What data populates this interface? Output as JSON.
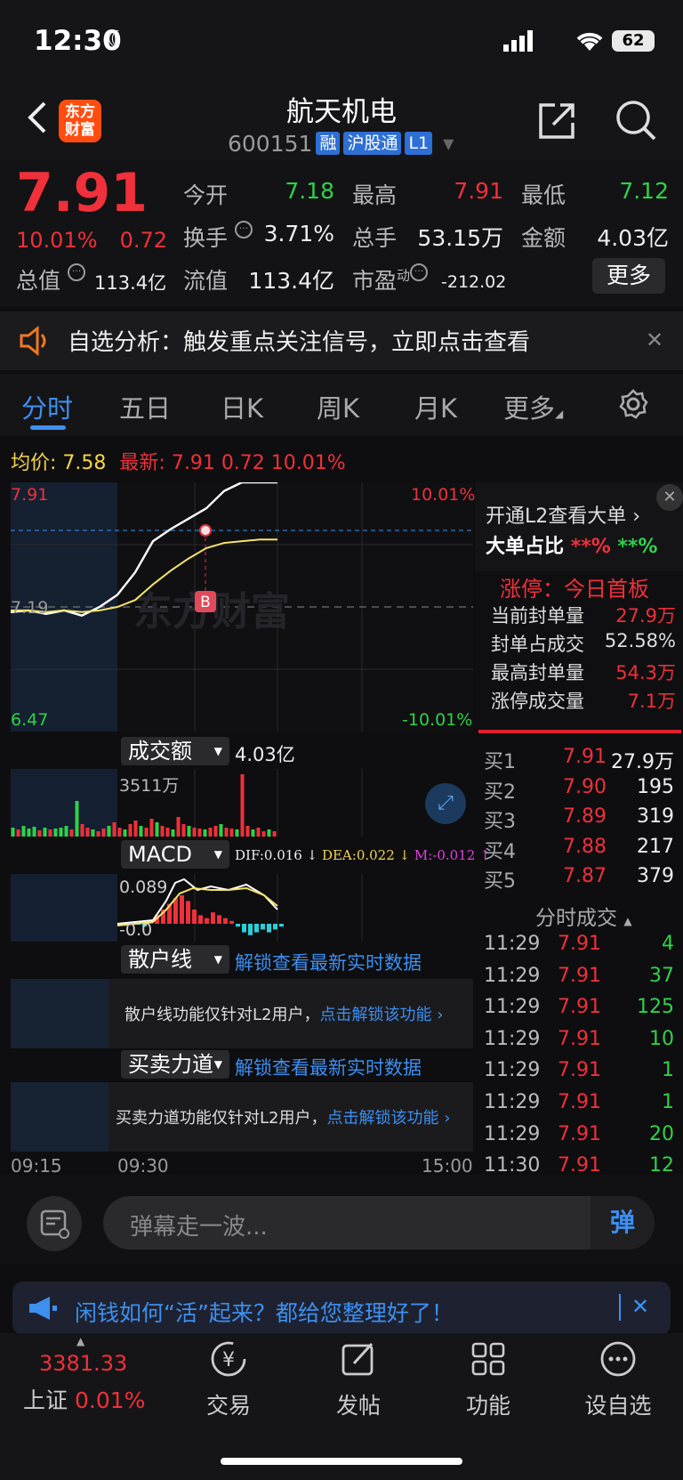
{
  "status": {
    "time": "12:30",
    "battery": "62"
  },
  "header": {
    "title": "航天机电",
    "code": "600151",
    "tags": [
      "融",
      "沪股通",
      "L1"
    ],
    "logo": "东方财富"
  },
  "quote": {
    "price": "7.91",
    "pct": "10.01%",
    "change": "0.72",
    "open_label": "今开",
    "open": "7.18",
    "high_label": "最高",
    "high": "7.91",
    "low_label": "最低",
    "low": "7.12",
    "turnover_label": "换手",
    "turnover": "3.71%",
    "volume_label": "总手",
    "volume": "53.15万",
    "amount_label": "金额",
    "amount": "4.03亿",
    "mktcap_label": "总值",
    "mktcap": "113.4亿",
    "float_label": "流值",
    "float": "113.4亿",
    "pe_label": "市盈",
    "pe_sup": "动",
    "pe": "-212.02",
    "more": "更多"
  },
  "banner": {
    "text": "自选分析：触发重点关注信号，立即点击查看"
  },
  "tabs": [
    "分时",
    "五日",
    "日K",
    "周K",
    "月K",
    "更多"
  ],
  "summary": {
    "avg_label": "均价:",
    "avg": "7.58",
    "latest_label": "最新:",
    "latest": "7.91",
    "chg": "0.72",
    "pct": "10.01%"
  },
  "chart_data": {
    "type": "line",
    "price_max": "7.91",
    "price_ref": "7.19",
    "price_min": "6.47",
    "pct_max": "10.01%",
    "pct_min": "-10.01%",
    "watermark": "东方财富",
    "marker": "B",
    "x_ticks": [
      "09:15",
      "09:30",
      "15:00"
    ],
    "ylim": [
      6.47,
      7.91
    ],
    "series": [
      {
        "values": [
          7.16,
          7.17,
          7.15,
          7.17,
          7.14,
          7.19,
          7.26,
          7.39,
          7.57,
          7.64,
          7.7,
          7.76,
          7.86,
          7.91,
          7.91,
          7.91
        ]
      },
      {
        "values": [
          7.17,
          7.17,
          7.16,
          7.17,
          7.16,
          7.17,
          7.19,
          7.23,
          7.32,
          7.4,
          7.47,
          7.53,
          7.56,
          7.57,
          7.58,
          7.58
        ]
      }
    ]
  },
  "volume": {
    "label": "成交额",
    "total": "4.03亿",
    "max": "3511万"
  },
  "macd": {
    "label": "MACD",
    "dif": "DIF:0.016 ↓",
    "dea": "DEA:0.022 ↓",
    "m": "M:-0.012 ↑",
    "top": "0.089",
    "bottom": "-0.0"
  },
  "retail": {
    "label": "散户线",
    "link": "解锁查看最新实时数据",
    "msg": "散户线功能仅针对L2用户，",
    "unlock": "点击解锁该功能"
  },
  "force": {
    "label": "买卖力道",
    "link": "解锁查看最新实时数据",
    "msg": "买卖力道功能仅针对L2用户，",
    "unlock": "点击解锁该功能"
  },
  "right_panel": {
    "l2_link": "开通L2查看大单",
    "big_order": "大单占比",
    "big_red": "**%",
    "big_green": "**%",
    "limit_title": "涨停：今日首板",
    "rows": [
      {
        "label": "当前封单量",
        "value": "27.9万"
      },
      {
        "label": "封单占成交",
        "value": "52.58%"
      },
      {
        "label": "最高封单量",
        "value": "54.3万"
      },
      {
        "label": "涨停成交量",
        "value": "7.1万"
      }
    ],
    "bids": [
      {
        "label": "买1",
        "price": "7.91",
        "vol": "27.9万"
      },
      {
        "label": "买2",
        "price": "7.90",
        "vol": "195"
      },
      {
        "label": "买3",
        "price": "7.89",
        "vol": "319"
      },
      {
        "label": "买4",
        "price": "7.88",
        "vol": "217"
      },
      {
        "label": "买5",
        "price": "7.87",
        "vol": "379"
      }
    ],
    "ticks_title": "分时成交",
    "ticks": [
      {
        "t": "11:29",
        "p": "7.91",
        "v": "4"
      },
      {
        "t": "11:29",
        "p": "7.91",
        "v": "37"
      },
      {
        "t": "11:29",
        "p": "7.91",
        "v": "125"
      },
      {
        "t": "11:29",
        "p": "7.91",
        "v": "10"
      },
      {
        "t": "11:29",
        "p": "7.91",
        "v": "1"
      },
      {
        "t": "11:29",
        "p": "7.91",
        "v": "1"
      },
      {
        "t": "11:29",
        "p": "7.91",
        "v": "20"
      },
      {
        "t": "11:30",
        "p": "7.91",
        "v": "12"
      }
    ]
  },
  "danmu": {
    "placeholder": "弹幕走一波...",
    "btn": "弹"
  },
  "ad": {
    "text": "闲钱如何“活”起来？都给您整理好了！"
  },
  "tabbar": {
    "index_value": "3381.33",
    "index_name": "上证",
    "index_pct": "0.01%",
    "items": [
      "交易",
      "发帖",
      "功能",
      "设自选"
    ]
  }
}
